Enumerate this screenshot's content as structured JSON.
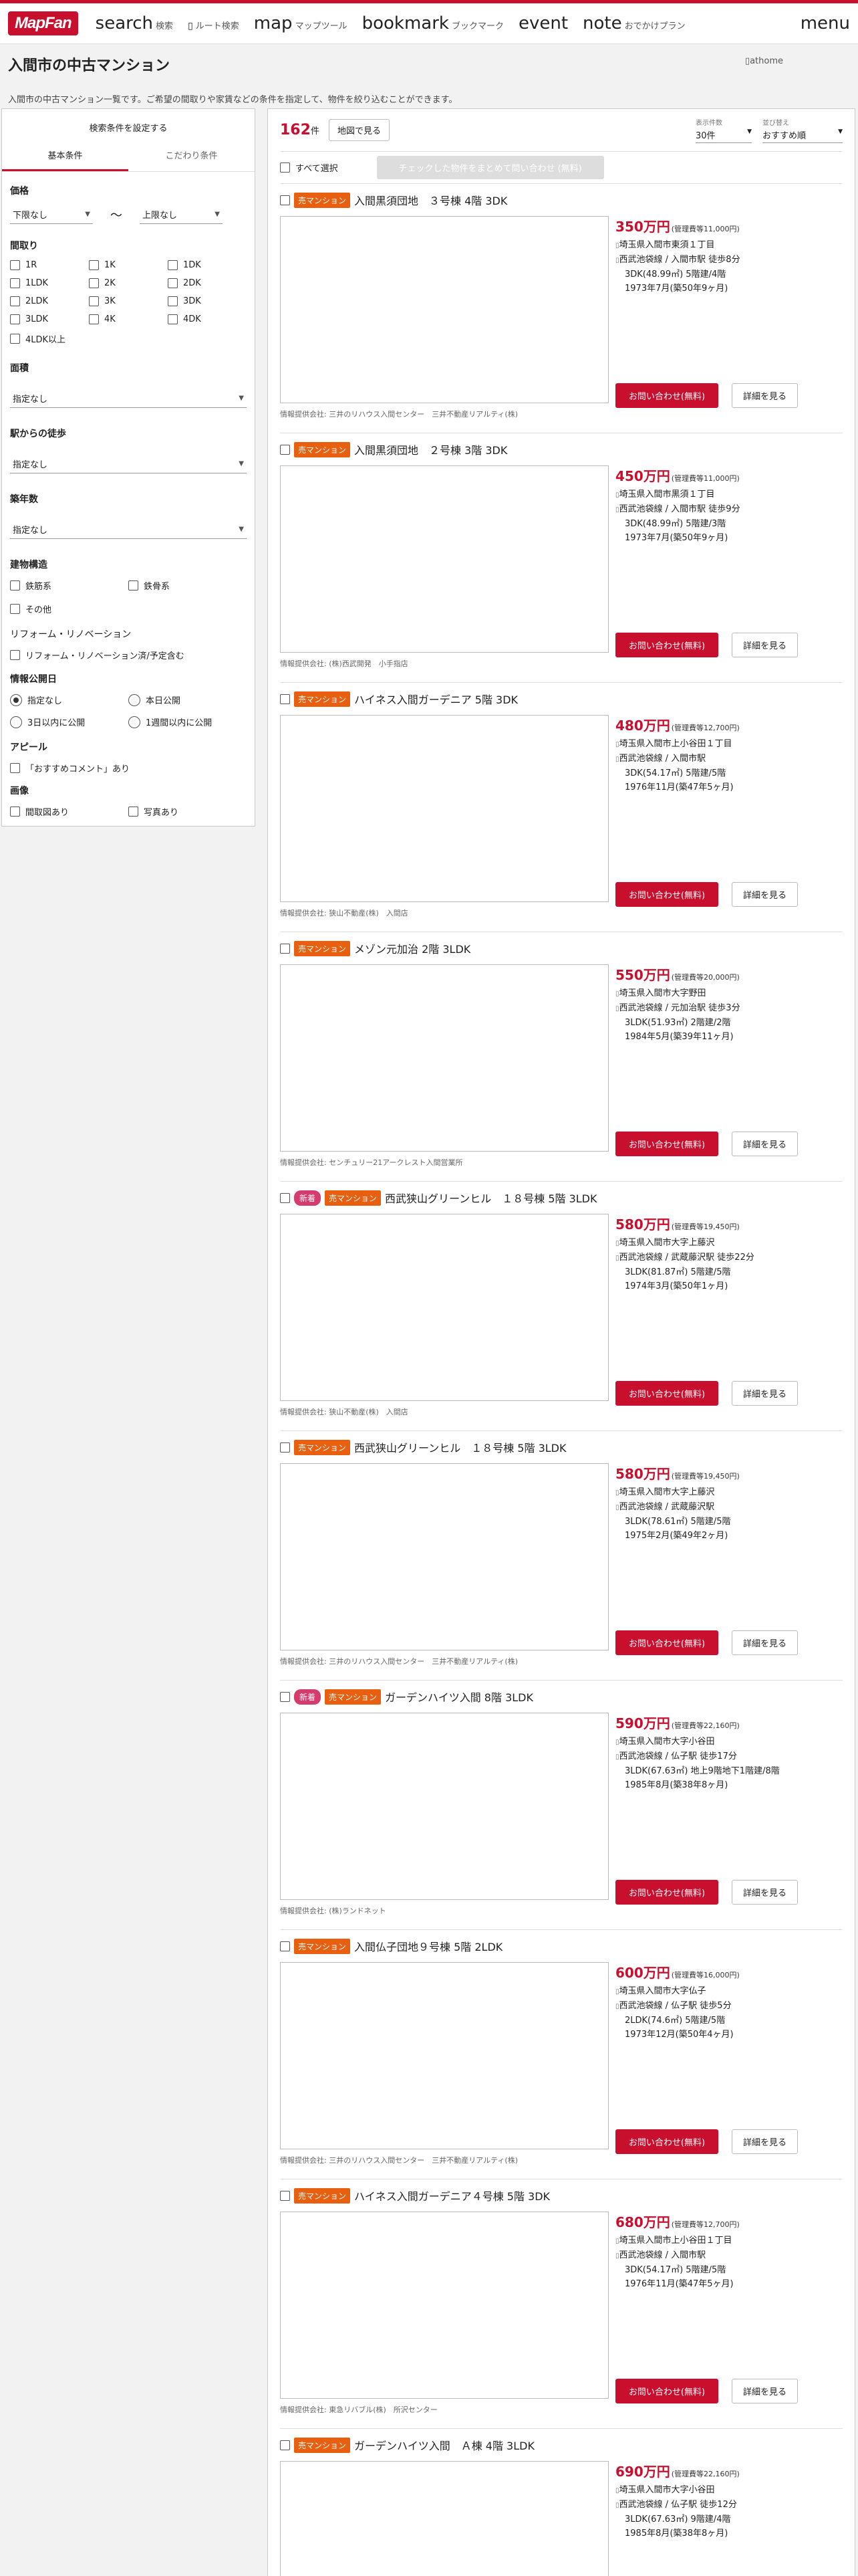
{
  "header": {
    "logo": "MapFan",
    "nav": [
      {
        "main": "search",
        "sub": "検索"
      },
      {
        "main": "",
        "sub": "ルート検索",
        "icon": "route-icon"
      },
      {
        "main": "map",
        "sub": "マップツール"
      },
      {
        "main": "bookmark",
        "sub": "ブックマーク"
      },
      {
        "main": "event",
        "sub": ""
      },
      {
        "main": "note",
        "sub": "おでかけプラン"
      }
    ],
    "menu": "menu"
  },
  "page": {
    "title": "入間市の中古マンション",
    "description": "入間市の中古マンション一覧です。ご希望の間取りや家賃などの条件を指定して、物件を絞り込むことができます。",
    "athome_alt": "athome"
  },
  "sidebar": {
    "heading": "検索条件を設定する",
    "tabs": [
      "基本条件",
      "こだわり条件"
    ],
    "price": {
      "title": "価格",
      "min": "下限なし",
      "max": "上限なし",
      "sep": "〜"
    },
    "layout": {
      "title": "間取り",
      "options": [
        "1R",
        "1K",
        "1DK",
        "1LDK",
        "2K",
        "2DK",
        "2LDK",
        "3K",
        "3DK",
        "3LDK",
        "4K",
        "4DK",
        "4LDK以上"
      ]
    },
    "area": {
      "title": "面積",
      "value": "指定なし"
    },
    "walk": {
      "title": "駅からの徒歩",
      "value": "指定なし"
    },
    "age": {
      "title": "築年数",
      "value": "指定なし"
    },
    "structure": {
      "title": "建物構造",
      "options": [
        "鉄筋系",
        "鉄骨系",
        "その他"
      ]
    },
    "reform": {
      "title": "リフォーム・リノベーション",
      "option": "リフォーム・リノベーション済/予定含む"
    },
    "published": {
      "title": "情報公開日",
      "options": [
        "指定なし",
        "本日公開",
        "3日以内に公開",
        "1週間以内に公開"
      ]
    },
    "appeal": {
      "title": "アピール",
      "option": "「おすすめコメント」あり"
    },
    "image": {
      "title": "画像",
      "options": [
        "間取図あり",
        "写真あり"
      ]
    }
  },
  "results": {
    "count": "162",
    "count_unit": "件",
    "map_button": "地図で見る",
    "sort1_label": "表示件数",
    "sort1_value": "30件",
    "sort2_label": "並び替え",
    "sort2_value": "おすすめ順",
    "select_all": "すべて選択",
    "bulk_inquiry": "チェックした物件をまとめて問い合わせ (無料)",
    "contact_label": "お問い合わせ(無料)",
    "detail_label": "詳細を見る",
    "listings": [
      {
        "new": "",
        "type": "売マンション",
        "title": "入間黒須団地　３号棟 4階 3DK",
        "price": "350万円",
        "mgmt": "(管理費等11,000円)",
        "address": "埼玉県入間市東須１丁目",
        "station": "西武池袋線 / 入間市駅 徒歩8分",
        "spec": "3DK(48.99㎡) 5階建/4階",
        "built": "1973年7月(築50年9ヶ月)",
        "provider": "情報提供会社: 三井のリハウス入間センター　三井不動産リアルティ(株)"
      },
      {
        "new": "",
        "type": "売マンション",
        "title": "入間黒須団地　２号棟 3階 3DK",
        "price": "450万円",
        "mgmt": "(管理費等11,000円)",
        "address": "埼玉県入間市黒須１丁目",
        "station": "西武池袋線 / 入間市駅 徒歩9分",
        "spec": "3DK(48.99㎡) 5階建/3階",
        "built": "1973年7月(築50年9ヶ月)",
        "provider": "情報提供会社: (株)西武開発　小手指店"
      },
      {
        "new": "",
        "type": "売マンション",
        "title": "ハイネス入間ガーデニア 5階 3DK",
        "price": "480万円",
        "mgmt": "(管理費等12,700円)",
        "address": "埼玉県入間市上小谷田１丁目",
        "station": "西武池袋線 / 入間市駅",
        "spec": "3DK(54.17㎡) 5階建/5階",
        "built": "1976年11月(築47年5ヶ月)",
        "provider": "情報提供会社: 狭山不動産(株)　入間店"
      },
      {
        "new": "",
        "type": "売マンション",
        "title": "メゾン元加治 2階 3LDK",
        "price": "550万円",
        "mgmt": "(管理費等20,000円)",
        "address": "埼玉県入間市大字野田",
        "station": "西武池袋線 / 元加治駅 徒歩3分",
        "spec": "3LDK(51.93㎡) 2階建/2階",
        "built": "1984年5月(築39年11ヶ月)",
        "provider": "情報提供会社: センチュリー21アークレスト入間営業所"
      },
      {
        "new": "新着",
        "type": "売マンション",
        "title": "西武狭山グリーンヒル　１８号棟 5階 3LDK",
        "price": "580万円",
        "mgmt": "(管理費等19,450円)",
        "address": "埼玉県入間市大字上藤沢",
        "station": "西武池袋線 / 武蔵藤沢駅 徒歩22分",
        "spec": "3LDK(81.87㎡) 5階建/5階",
        "built": "1974年3月(築50年1ヶ月)",
        "provider": "情報提供会社: 狭山不動産(株)　入間店"
      },
      {
        "new": "",
        "type": "売マンション",
        "title": "西武狭山グリーンヒル　１８号棟 5階 3LDK",
        "price": "580万円",
        "mgmt": "(管理費等19,450円)",
        "address": "埼玉県入間市大字上藤沢",
        "station": "西武池袋線 / 武蔵藤沢駅",
        "spec": "3LDK(78.61㎡) 5階建/5階",
        "built": "1975年2月(築49年2ヶ月)",
        "provider": "情報提供会社: 三井のリハウス入間センター　三井不動産リアルティ(株)"
      },
      {
        "new": "新着",
        "type": "売マンション",
        "title": "ガーデンハイツ入間 8階 3LDK",
        "price": "590万円",
        "mgmt": "(管理費等22,160円)",
        "address": "埼玉県入間市大字小谷田",
        "station": "西武池袋線 / 仏子駅 徒歩17分",
        "spec": "3LDK(67.63㎡) 地上9階地下1階建/8階",
        "built": "1985年8月(築38年8ヶ月)",
        "provider": "情報提供会社: (株)ランドネット"
      },
      {
        "new": "",
        "type": "売マンション",
        "title": "入間仏子団地９号棟 5階 2LDK",
        "price": "600万円",
        "mgmt": "(管理費等16,000円)",
        "address": "埼玉県入間市大字仏子",
        "station": "西武池袋線 / 仏子駅 徒歩5分",
        "spec": "2LDK(74.6㎡) 5階建/5階",
        "built": "1973年12月(築50年4ヶ月)",
        "provider": "情報提供会社: 三井のリハウス入間センター　三井不動産リアルティ(株)"
      },
      {
        "new": "",
        "type": "売マンション",
        "title": "ハイネス入間ガーデニア４号棟 5階 3DK",
        "price": "680万円",
        "mgmt": "(管理費等12,700円)",
        "address": "埼玉県入間市上小谷田１丁目",
        "station": "西武池袋線 / 入間市駅",
        "spec": "3DK(54.17㎡) 5階建/5階",
        "built": "1976年11月(築47年5ヶ月)",
        "provider": "情報提供会社: 東急リバブル(株)　所沢センター"
      },
      {
        "new": "",
        "type": "売マンション",
        "title": "ガーデンハイツ入間　Ａ棟 4階 3LDK",
        "price": "690万円",
        "mgmt": "(管理費等22,160円)",
        "address": "埼玉県入間市大字小谷田",
        "station": "西武池袋線 / 仏子駅 徒歩12分",
        "spec": "3LDK(67.63㎡) 9階建/4階",
        "built": "1985年8月(築38年8ヶ月)",
        "provider": ""
      }
    ]
  }
}
